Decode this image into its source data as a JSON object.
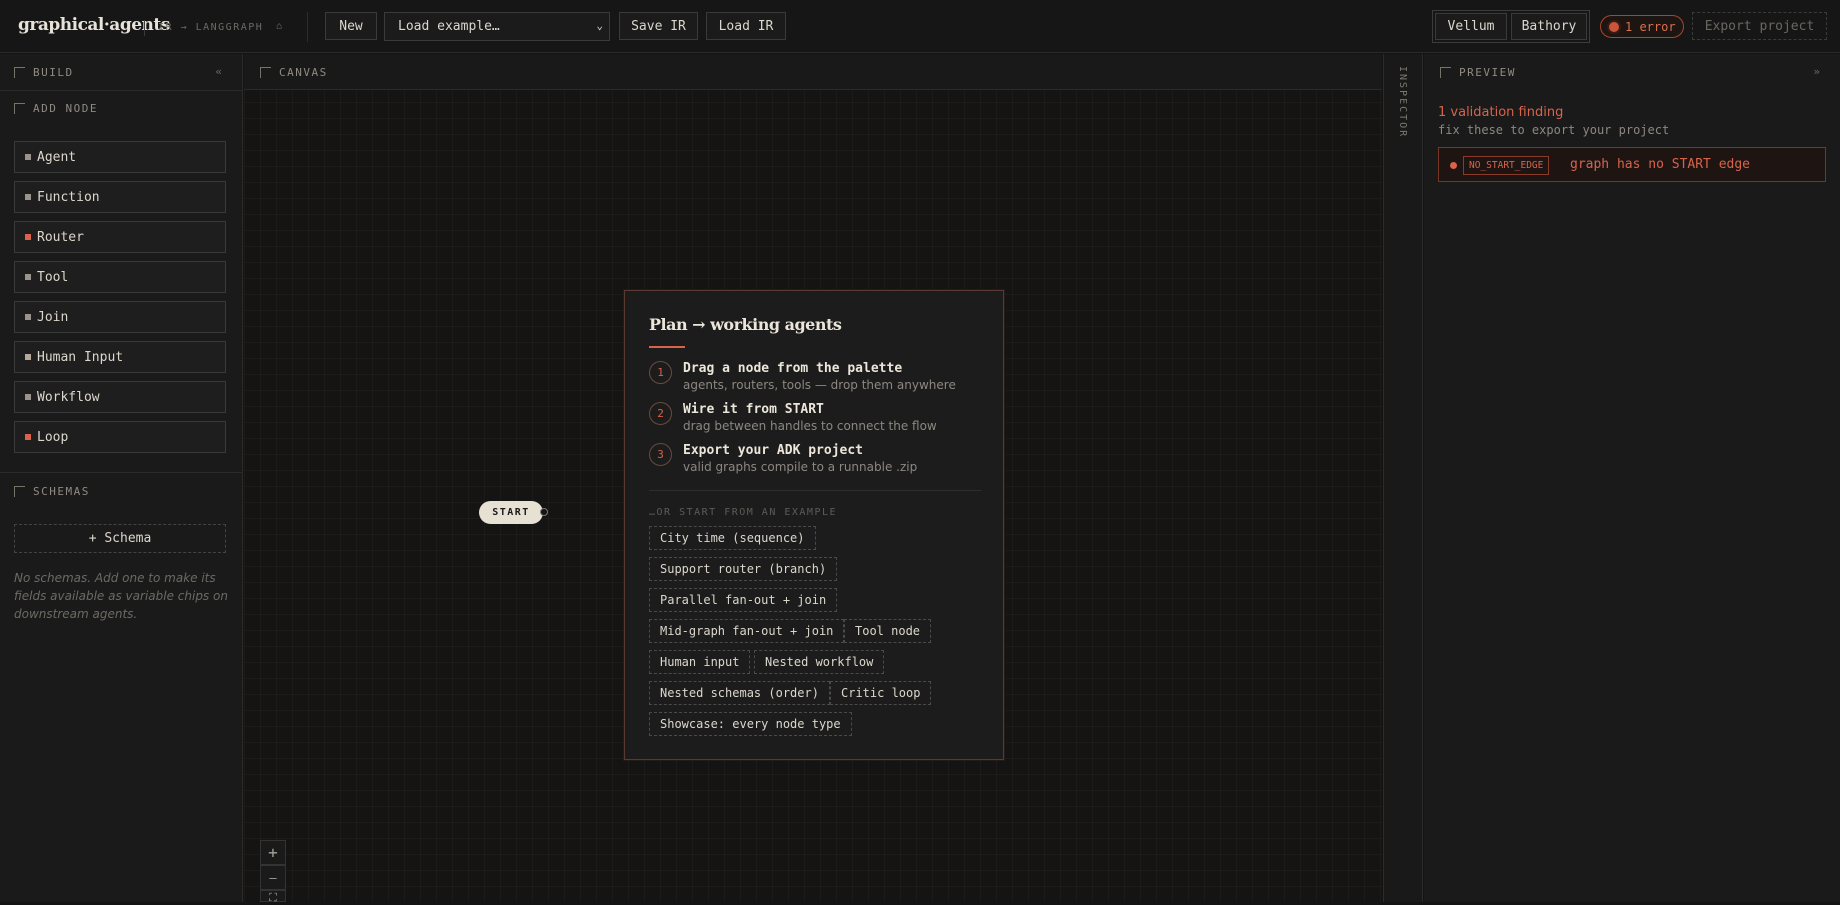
{
  "header": {
    "brand": "graphical·agents",
    "subtitle": "IR → LANGGRAPH",
    "new_label": "New",
    "load_example_label": "Load example…",
    "save_ir_label": "Save IR",
    "load_ir_label": "Load IR",
    "theme_options": [
      "Vellum",
      "Bathory"
    ],
    "error_badge": "1 error",
    "export_label": "Export project"
  },
  "sidebar": {
    "build_title": "BUILD",
    "collapse_glyph": "«",
    "add_node_title": "ADD NODE",
    "nodes": [
      {
        "label": "Agent",
        "accent": false
      },
      {
        "label": "Function",
        "accent": false
      },
      {
        "label": "Router",
        "accent": true
      },
      {
        "label": "Tool",
        "accent": false
      },
      {
        "label": "Join",
        "accent": false
      },
      {
        "label": "Human Input",
        "accent": false
      },
      {
        "label": "Workflow",
        "accent": false
      },
      {
        "label": "Loop",
        "accent": true
      }
    ],
    "schemas_title": "SCHEMAS",
    "add_schema_label": "+ Schema",
    "schemas_empty_note": "No schemas. Add one to make its fields available as variable chips on downstream agents."
  },
  "canvas": {
    "title": "CANVAS",
    "start_label": "START",
    "zoom_in": "+",
    "zoom_out": "—",
    "fit": "⛶",
    "onboarding": {
      "title": "Plan → working agents",
      "steps": [
        {
          "num": "1",
          "title": "Drag a node from the palette",
          "sub": "agents, routers, tools — drop them anywhere"
        },
        {
          "num": "2",
          "title": "Wire it from START",
          "sub": "drag between handles to connect the flow"
        },
        {
          "num": "3",
          "title": "Export your ADK project",
          "sub": "valid graphs compile to a runnable .zip"
        }
      ],
      "or_label": "…OR START FROM AN EXAMPLE",
      "examples": [
        "City time (sequence)",
        "Support router (branch)",
        "Parallel fan-out + join",
        "Mid-graph fan-out + join",
        "Tool node",
        "Human input",
        "Nested workflow",
        "Nested schemas (order)",
        "Critic loop",
        "Showcase: every node type"
      ]
    }
  },
  "inspector": {
    "label": "INSPECTOR"
  },
  "preview": {
    "title": "PREVIEW",
    "collapse_glyph": "»",
    "validation_title": "1 validation finding",
    "validation_sub": "fix these to export your project",
    "finding_code": "NO_START_EDGE",
    "finding_message": "graph has no START edge"
  },
  "colors": {
    "accent": "#d8634a",
    "background": "#141414",
    "panel": "#1a1a1a",
    "text": "#dcd7cd"
  }
}
